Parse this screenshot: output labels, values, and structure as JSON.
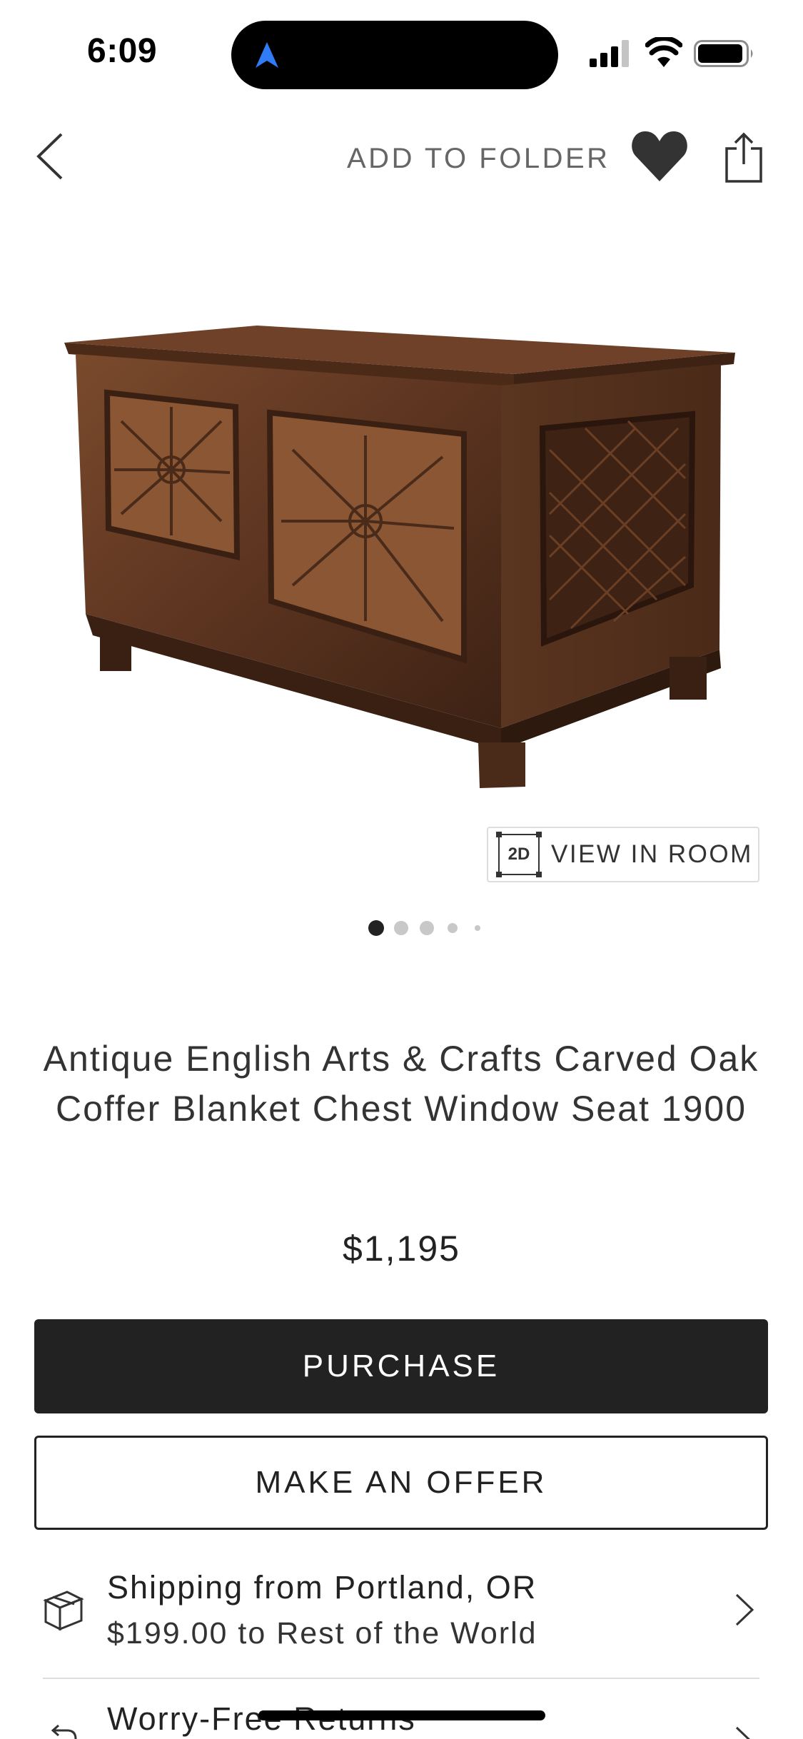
{
  "status_bar": {
    "time": "6:09"
  },
  "header": {
    "add_to_folder_label": "ADD TO FOLDER",
    "icons": [
      "chevron-left-icon",
      "heart-icon",
      "share-icon"
    ]
  },
  "product": {
    "image_alt": "Carved oak coffer chest",
    "view_in_room_badge": "2D",
    "view_in_room_label": "VIEW IN ROOM",
    "carousel": {
      "count": 5,
      "active_index": 0
    },
    "title": "Antique English Arts & Crafts Carved Oak Coffer Blanket Chest Window Seat 1900",
    "price": "$1,195"
  },
  "actions": {
    "purchase_label": "PURCHASE",
    "offer_label": "MAKE AN OFFER"
  },
  "info": {
    "shipping_line1": "Shipping from Portland, OR",
    "shipping_line2": "$199.00 to Rest of the World",
    "returns_line1": "Worry-Free Returns"
  },
  "colors": {
    "primary_button": "#222222",
    "nav_arrow": "#2f7cf6",
    "text_muted": "#666666"
  }
}
